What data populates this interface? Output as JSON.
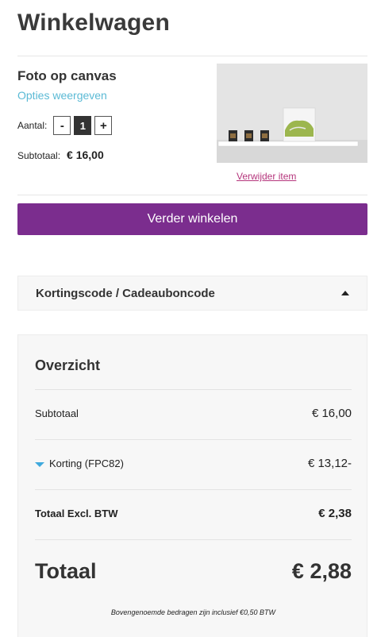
{
  "page": {
    "title": "Winkelwagen"
  },
  "cart_item": {
    "name": "Foto op canvas",
    "options_link": "Opties weergeven",
    "quantity_label": "Aantal:",
    "quantity_minus": "-",
    "quantity_value": "1",
    "quantity_plus": "+",
    "subtotal_label": "Subtotaal:",
    "subtotal_value": "€ 16,00",
    "remove_link": "Verwijder item"
  },
  "actions": {
    "continue_shopping": "Verder winkelen"
  },
  "coupon": {
    "title": "Kortingscode / Cadeauboncode",
    "icon": "chevron-up-icon"
  },
  "summary": {
    "title": "Overzicht",
    "subtotal_label": "Subtotaal",
    "subtotal_value": "€ 16,00",
    "discount_label": "Korting (FPC82)",
    "discount_value": "€ 13,12-",
    "excl_label": "Totaal Excl. BTW",
    "excl_value": "€ 2,38",
    "total_label": "Totaal",
    "total_value": "€ 2,88",
    "vat_note": "Bovengenoemde bedragen zijn inclusief €0,50 BTW"
  },
  "colors": {
    "primary_button": "#7b2d8e",
    "link_options": "#5bbad5",
    "link_remove": "#b5357c",
    "discount_caret": "#3fa9dd"
  }
}
